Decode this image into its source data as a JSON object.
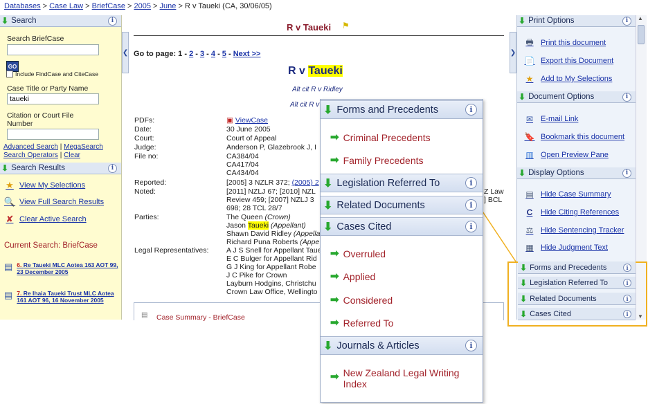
{
  "breadcrumb": {
    "items": [
      "Databases",
      "Case Law",
      "BriefCase",
      "2005",
      "June"
    ],
    "current": "R v Taueki (CA, 30/06/05)",
    "separator": ">"
  },
  "search_panel": {
    "title": "Search",
    "search_briefcase_label": "Search BriefCase",
    "search_briefcase_value": "",
    "go_label": "GO",
    "include_label": "Include FindCase and CiteCase",
    "case_title_label": "Case Title or Party Name",
    "case_title_value": "taueki",
    "citation_label": "Citation or Court File Number",
    "citation_value": "",
    "links": [
      "Advanced Search",
      "MegaSearch",
      "Search Operators",
      "Clear"
    ]
  },
  "results_panel": {
    "title": "Search Results",
    "items": [
      {
        "label": "View My Selections",
        "icon": "star-icon"
      },
      {
        "label": "View Full Search Results",
        "icon": "search-results-icon"
      },
      {
        "label": "Clear Active Search",
        "icon": "clear-search-icon"
      }
    ],
    "current_search": "Current Search: BriefCase",
    "documents": [
      {
        "num": "6.",
        "text": "Re Taueki MLC Aotea 163 AOT 99, 23 December 2005"
      },
      {
        "num": "7.",
        "text": "Re Ihaia Taueki Trust MLC Aotea 161 AOT 96, 16 November 2005"
      }
    ]
  },
  "document": {
    "header_title": "R v Taueki",
    "goto_label": "Go to page:",
    "pages": [
      "1",
      "2",
      "3",
      "4",
      "5"
    ],
    "next_label": "Next >>",
    "main_title_prefix": "R v ",
    "main_title_highlight": "Taueki",
    "altcit_1": "Alt cit R v Ridley",
    "altcit_2": "Alt cit R v",
    "fields": {
      "pdfs_label": "PDFs:",
      "pdfs_value": "ViewCase",
      "date_label": "Date:",
      "date_value": "30 June 2005",
      "court_label": "Court:",
      "court_value": "Court of Appeal",
      "judge_label": "Judge:",
      "judge_value": "Anderson P, Glazebrook J, I",
      "fileno_label": "File no:",
      "fileno_1": "CA384/04",
      "fileno_2": "CA417/04",
      "fileno_3": "CA434/04",
      "reported_label": "Reported:",
      "reported_value": "[2005] 3 NZLR 372;",
      "reported_link": "(2005) 2",
      "noted_label": "Noted:",
      "noted_1": "[2011] NZLJ 67; [2010] NZL",
      "noted_1b": "Z Law",
      "noted_2": "Review 459; [2007] NZLJ 3",
      "noted_2b": "] BCL",
      "noted_3": "698; 28 TCL 28/7",
      "parties_label": "Parties:",
      "party_1": "The Queen",
      "party_1_role": "(Crown)",
      "party_2_first": "Jason ",
      "party_2_hl": "Taueki",
      "party_2_role": "(Appellant)",
      "party_3": "Shawn David Ridley",
      "party_3_role": "(Appella",
      "party_4": "Richard Puna Roberts",
      "party_4_role": "(Appe",
      "legal_label": "Legal Representatives:",
      "legal_1": "A J S Snell for Appellant Taue",
      "legal_2": "E C Bulger for Appellant Rid",
      "legal_3": "G J King for Appellant Robe",
      "legal_4": "J C Pike for Crown",
      "legal_5": "Layburn Hodgins, Christchu",
      "legal_6": "Crown Law Office, Wellingto"
    },
    "case_summary_label": "Case Summary - BriefCase"
  },
  "right_panel": {
    "print_title": "Print Options",
    "print_items": [
      {
        "label": "Print this document",
        "icon": "printer-icon"
      },
      {
        "label": "Export this Document",
        "icon": "export-icon"
      },
      {
        "label": "Add to My Selections",
        "icon": "star-icon"
      }
    ],
    "doc_title": "Document Options",
    "doc_items": [
      {
        "label": "E-mail Link",
        "icon": "email-icon"
      },
      {
        "label": "Bookmark this document",
        "icon": "bookmark-icon"
      },
      {
        "label": "Open Preview Pane",
        "icon": "preview-pane-icon"
      }
    ],
    "display_title": "Display Options",
    "display_items": [
      {
        "label": "Hide Case Summary",
        "icon": "summary-icon"
      },
      {
        "label": "Hide Citing References",
        "icon": "citing-icon"
      },
      {
        "label": "Hide Sentencing Tracker",
        "icon": "sentencing-icon"
      },
      {
        "label": "Hide Judgment Text",
        "icon": "judgment-icon"
      }
    ],
    "collapsed_sections": [
      "Forms and Precedents",
      "Legislation Referred To",
      "Related Documents",
      "Cases Cited"
    ]
  },
  "popup": {
    "forms_title": "Forms and Precedents",
    "forms_items": [
      "Criminal Precedents",
      "Family Precedents"
    ],
    "legislation_title": "Legislation Referred To",
    "related_title": "Related Documents",
    "cases_title": "Cases Cited",
    "cases_items": [
      "Overruled",
      "Applied",
      "Considered",
      "Referred To"
    ],
    "journals_title": "Journals & Articles",
    "journals_items": [
      "New Zealand Legal Writing Index"
    ]
  },
  "colors": {
    "accent": "#f0b020",
    "link": "#1a33a8",
    "heading_red": "#a2222a",
    "highlight": "#ffff00"
  }
}
